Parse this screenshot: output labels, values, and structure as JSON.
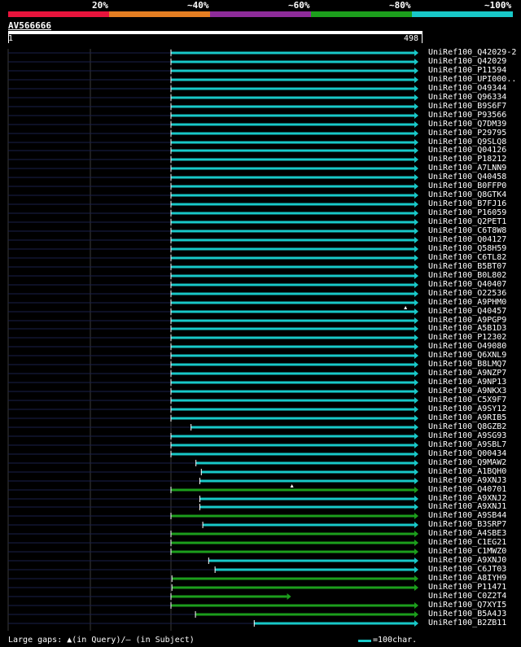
{
  "identity_legend": {
    "labels": [
      "20%",
      "~40%",
      "~60%",
      "~80%",
      "~100%"
    ],
    "colors": [
      "#e8143c",
      "#e57e22",
      "#8e2c9a",
      "#1c9e1c",
      "#18c8c8"
    ]
  },
  "query": {
    "id": "AV566666",
    "start": "1",
    "end": "498"
  },
  "hits": [
    {
      "name": "UniRef100_Q42029-2",
      "start": 1,
      "end": 498,
      "tier": 4,
      "arrow": "right"
    },
    {
      "name": "UniRef100_Q42029",
      "start": 1,
      "end": 498,
      "tier": 4,
      "arrow": "right"
    },
    {
      "name": "UniRef100_P11594",
      "start": 1,
      "end": 498,
      "tier": 4,
      "arrow": "right"
    },
    {
      "name": "UniRef100_UPI000..",
      "start": 1,
      "end": 498,
      "tier": 4,
      "arrow": "right"
    },
    {
      "name": "UniRef100_O49344",
      "start": 1,
      "end": 498,
      "tier": 4,
      "arrow": "right"
    },
    {
      "name": "UniRef100_Q96334",
      "start": 1,
      "end": 498,
      "tier": 4,
      "arrow": "right"
    },
    {
      "name": "UniRef100_B9S6F7",
      "start": 1,
      "end": 498,
      "tier": 4,
      "arrow": "right"
    },
    {
      "name": "UniRef100_P93566",
      "start": 1,
      "end": 498,
      "tier": 4,
      "arrow": "right"
    },
    {
      "name": "UniRef100_Q7DM39",
      "start": 1,
      "end": 498,
      "tier": 4,
      "arrow": "right"
    },
    {
      "name": "UniRef100_P29795",
      "start": 1,
      "end": 498,
      "tier": 4,
      "arrow": "right"
    },
    {
      "name": "UniRef100_Q9SLQ8",
      "start": 1,
      "end": 498,
      "tier": 4,
      "arrow": "right"
    },
    {
      "name": "UniRef100_Q04126",
      "start": 1,
      "end": 498,
      "tier": 4,
      "arrow": "right"
    },
    {
      "name": "UniRef100_P18212",
      "start": 1,
      "end": 498,
      "tier": 4,
      "arrow": "right"
    },
    {
      "name": "UniRef100_A7LNN9",
      "start": 1,
      "end": 498,
      "tier": 4,
      "arrow": "right"
    },
    {
      "name": "UniRef100_Q40458",
      "start": 1,
      "end": 498,
      "tier": 4,
      "arrow": "right"
    },
    {
      "name": "UniRef100_B0FFP0",
      "start": 1,
      "end": 498,
      "tier": 4,
      "arrow": "right"
    },
    {
      "name": "UniRef100_Q8GTK4",
      "start": 1,
      "end": 498,
      "tier": 4,
      "arrow": "right"
    },
    {
      "name": "UniRef100_B7FJ16",
      "start": 1,
      "end": 498,
      "tier": 4,
      "arrow": "right"
    },
    {
      "name": "UniRef100_P16059",
      "start": 1,
      "end": 498,
      "tier": 4,
      "arrow": "right"
    },
    {
      "name": "UniRef100_Q2PET1",
      "start": 1,
      "end": 498,
      "tier": 4,
      "arrow": "right"
    },
    {
      "name": "UniRef100_C6T8W8",
      "start": 1,
      "end": 498,
      "tier": 4,
      "arrow": "right"
    },
    {
      "name": "UniRef100_Q04127",
      "start": 1,
      "end": 498,
      "tier": 4,
      "arrow": "right"
    },
    {
      "name": "UniRef100_Q58H59",
      "start": 1,
      "end": 498,
      "tier": 4,
      "arrow": "right"
    },
    {
      "name": "UniRef100_C6TL82",
      "start": 1,
      "end": 498,
      "tier": 4,
      "arrow": "right"
    },
    {
      "name": "UniRef100_B5BT07",
      "start": 1,
      "end": 498,
      "tier": 4,
      "arrow": "right"
    },
    {
      "name": "UniRef100_B0L802",
      "start": 1,
      "end": 498,
      "tier": 4,
      "arrow": "right"
    },
    {
      "name": "UniRef100_Q40407",
      "start": 1,
      "end": 498,
      "tier": 4,
      "arrow": "right"
    },
    {
      "name": "UniRef100_O22536",
      "start": 1,
      "end": 498,
      "tier": 4,
      "arrow": "right"
    },
    {
      "name": "UniRef100_A9PHM0",
      "start": 1,
      "end": 498,
      "tier": 4,
      "arrow": "right"
    },
    {
      "name": "UniRef100_Q40457",
      "start": 1,
      "end": 498,
      "tier": 4,
      "arrow": "right",
      "gap_at": 480
    },
    {
      "name": "UniRef100_A9PGP9",
      "start": 1,
      "end": 498,
      "tier": 4,
      "arrow": "right"
    },
    {
      "name": "UniRef100_A5B1D3",
      "start": 1,
      "end": 498,
      "tier": 4,
      "arrow": "right"
    },
    {
      "name": "UniRef100_P12302",
      "start": 1,
      "end": 498,
      "tier": 4,
      "arrow": "right"
    },
    {
      "name": "UniRef100_O49080",
      "start": 1,
      "end": 498,
      "tier": 4,
      "arrow": "right"
    },
    {
      "name": "UniRef100_Q6XNL9",
      "start": 1,
      "end": 498,
      "tier": 4,
      "arrow": "right"
    },
    {
      "name": "UniRef100_B8LMQ7",
      "start": 1,
      "end": 498,
      "tier": 4,
      "arrow": "right"
    },
    {
      "name": "UniRef100_A9NZP7",
      "start": 1,
      "end": 498,
      "tier": 4,
      "arrow": "right"
    },
    {
      "name": "UniRef100_A9NP13",
      "start": 1,
      "end": 498,
      "tier": 4,
      "arrow": "right"
    },
    {
      "name": "UniRef100_A9NKX3",
      "start": 1,
      "end": 498,
      "tier": 4,
      "arrow": "right"
    },
    {
      "name": "UniRef100_C5X9F7",
      "start": 1,
      "end": 498,
      "tier": 4,
      "arrow": "right"
    },
    {
      "name": "UniRef100_A9SY12",
      "start": 1,
      "end": 498,
      "tier": 4,
      "arrow": "right"
    },
    {
      "name": "UniRef100_A9RIB5",
      "start": 1,
      "end": 498,
      "tier": 4,
      "arrow": "right"
    },
    {
      "name": "UniRef100_Q8GZB2",
      "start": 42,
      "end": 498,
      "tier": 4,
      "arrow": "right"
    },
    {
      "name": "UniRef100_A9SG93",
      "start": 1,
      "end": 498,
      "tier": 4,
      "arrow": "right"
    },
    {
      "name": "UniRef100_A9SBL7",
      "start": 1,
      "end": 498,
      "tier": 4,
      "arrow": "right"
    },
    {
      "name": "UniRef100_Q00434",
      "start": 1,
      "end": 498,
      "tier": 4,
      "arrow": "right"
    },
    {
      "name": "UniRef100_Q9MAW2",
      "start": 52,
      "end": 498,
      "tier": 4,
      "arrow": "right"
    },
    {
      "name": "UniRef100_A1BQH0",
      "start": 63,
      "end": 498,
      "tier": 4,
      "arrow": "right"
    },
    {
      "name": "UniRef100_A9XNJ3",
      "start": 60,
      "end": 498,
      "tier": 4,
      "arrow": "right"
    },
    {
      "name": "UniRef100_Q40701",
      "start": 1,
      "end": 498,
      "tier": 3,
      "arrow": "right",
      "gap_at": 248
    },
    {
      "name": "UniRef100_A9XNJ2",
      "start": 60,
      "end": 498,
      "tier": 4,
      "arrow": "right"
    },
    {
      "name": "UniRef100_A9XNJ1",
      "start": 60,
      "end": 498,
      "tier": 4,
      "arrow": "right"
    },
    {
      "name": "UniRef100_A9SB44",
      "start": 1,
      "end": 498,
      "tier": 3,
      "arrow": "right"
    },
    {
      "name": "UniRef100_B3SRP7",
      "start": 66,
      "end": 498,
      "tier": 4,
      "arrow": "right"
    },
    {
      "name": "UniRef100_A4SBE3",
      "start": 1,
      "end": 498,
      "tier": 3,
      "arrow": "right"
    },
    {
      "name": "UniRef100_C1EG21",
      "start": 1,
      "end": 498,
      "tier": 3,
      "arrow": "right"
    },
    {
      "name": "UniRef100_C1MWZ0",
      "start": 1,
      "end": 498,
      "tier": 3,
      "arrow": "right"
    },
    {
      "name": "UniRef100_A9XNJ0",
      "start": 78,
      "end": 498,
      "tier": 4,
      "arrow": "right"
    },
    {
      "name": "UniRef100_C6JT03",
      "start": 91,
      "end": 498,
      "tier": 4,
      "arrow": "right"
    },
    {
      "name": "UniRef100_A8IYH9",
      "start": 3,
      "end": 498,
      "tier": 3,
      "arrow": "right"
    },
    {
      "name": "UniRef100_P11471",
      "start": 3,
      "end": 498,
      "tier": 3,
      "arrow": "right"
    },
    {
      "name": "UniRef100_C0Z2T4",
      "start": 1,
      "end": 238,
      "tier": 3,
      "arrow": "right"
    },
    {
      "name": "UniRef100_Q7XYI5",
      "start": 1,
      "end": 498,
      "tier": 3,
      "arrow": "right"
    },
    {
      "name": "UniRef100_B5A4J3",
      "start": 51,
      "end": 498,
      "tier": 3,
      "arrow": "right"
    },
    {
      "name": "UniRef100_B2ZB11",
      "start": 171,
      "end": 498,
      "tier": 4,
      "arrow": "right"
    }
  ],
  "footer": {
    "gaps_text": "Large gaps: ▲(in Query)/– (in Subject)",
    "scale_text": "=100char."
  }
}
